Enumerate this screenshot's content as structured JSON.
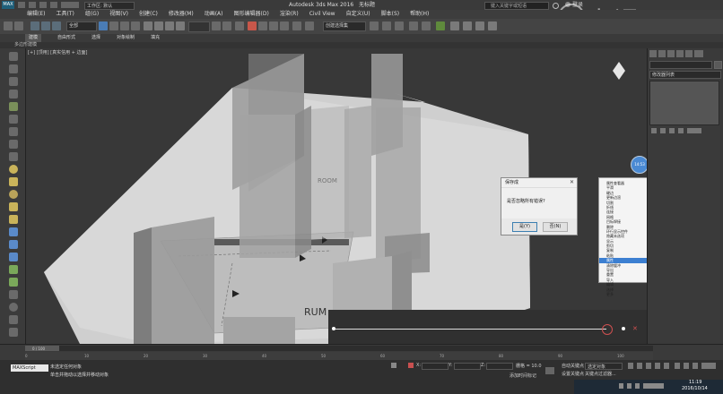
{
  "window": {
    "app_title": "Autodesk 3ds Max 2016",
    "doc_title": "无标题",
    "workspace": "工作区: 默认",
    "search_placeholder": "键入关键字或短语",
    "user": "登录",
    "watermark": "虎课网"
  },
  "menu": [
    "编辑(E)",
    "工具(T)",
    "组(G)",
    "视图(V)",
    "创建(C)",
    "修改器(M)",
    "动画(A)",
    "图形编辑器(D)",
    "渲染(R)",
    "Civil View",
    "自定义(U)",
    "脚本(S)",
    "帮助(H)"
  ],
  "toolbar": {
    "selection_filter": "全部",
    "named_sets": "创建选择集"
  },
  "ribbon": {
    "tabs": [
      "建模",
      "自由形式",
      "选择",
      "对象绘制",
      "填充"
    ],
    "sub": "多边形建模"
  },
  "viewport": {
    "label": "[+] [顶用] [真实信用 + 边面]",
    "text": [
      "ROOM",
      "RUM"
    ]
  },
  "dialog": {
    "title": "保存成",
    "message": "是否忽略所有错误?",
    "yes": "是(Y)",
    "no": "否(N)"
  },
  "quad_menu": {
    "items": [
      "属性查看器",
      "平滑",
      "硬边",
      "更新边渲",
      "切割",
      "折线",
      "连接",
      "网格",
      "目标焊接",
      "删除",
      "环行显示控件",
      "隐藏未选项",
      "显示",
      "剪切",
      "复制",
      "粘贴",
      "属性",
      "清除缓冲",
      "导出",
      "重置",
      "导入",
      "编辑",
      "选择",
      "更多"
    ],
    "highlight_index": 16,
    "button": "14:53"
  },
  "command_panel": {
    "modifier_list": "修改器列表"
  },
  "timeline": {
    "frame": "0 / 100",
    "ticks": [
      "0",
      "10",
      "20",
      "30",
      "40",
      "50",
      "60",
      "70",
      "80",
      "90",
      "100"
    ]
  },
  "status": {
    "line1": "未选定任何对象",
    "line2": "单击并拖动以选择并移动对象",
    "maxscript": "MAXScript",
    "x_label": "X:",
    "y_label": "Y:",
    "z_label": "Z:",
    "grid": "栅格 = 10.0",
    "auto_key": "自动关键点",
    "set_key": "设置关键点",
    "filter": "关键点过滤器...",
    "selected": "选定对象",
    "add_time_tag": "添加时间标记"
  },
  "clock": {
    "time": "11:19",
    "date": "2016/10/14"
  }
}
